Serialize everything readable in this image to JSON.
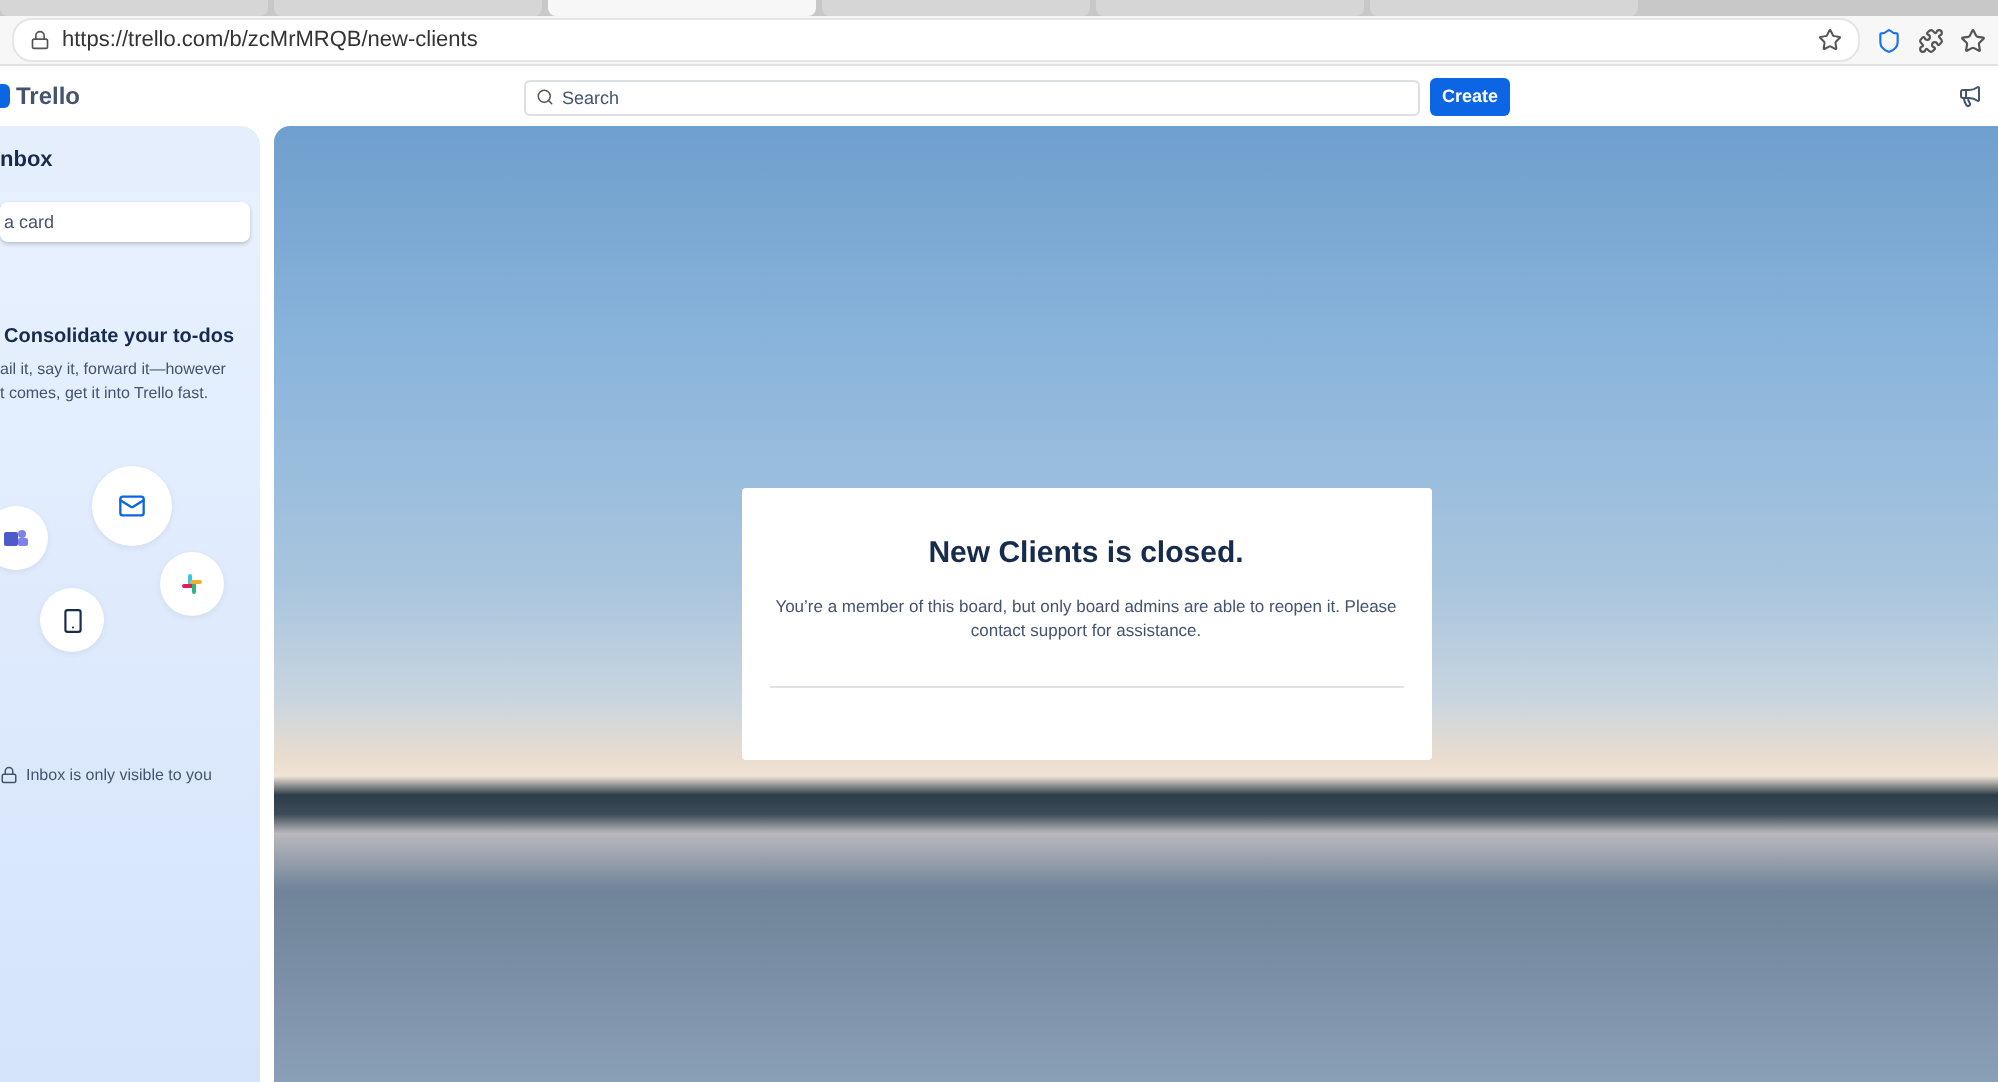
{
  "browser": {
    "tabs": [
      {
        "selected": false
      },
      {
        "selected": false
      },
      {
        "selected": true
      },
      {
        "selected": false
      },
      {
        "selected": false
      },
      {
        "selected": false
      }
    ],
    "address": "https://trello.com/b/zcMrMRQB/new-clients"
  },
  "header": {
    "logo": "Trello",
    "search": {
      "placeholder": "Search"
    },
    "create_button": "Create"
  },
  "inbox": {
    "title": "nbox",
    "add_card": {
      "placeholder": "a card"
    },
    "promo_title": "Consolidate your to-dos",
    "promo_text": "ail it, say it, forward it—however\nt comes, get it into Trello fast.",
    "footer": "Inbox is only visible to you"
  },
  "dialog": {
    "title": "New Clients is closed.",
    "message": "You’re a member of this board, but only board admins are able to reopen it. Please contact support for assistance."
  }
}
